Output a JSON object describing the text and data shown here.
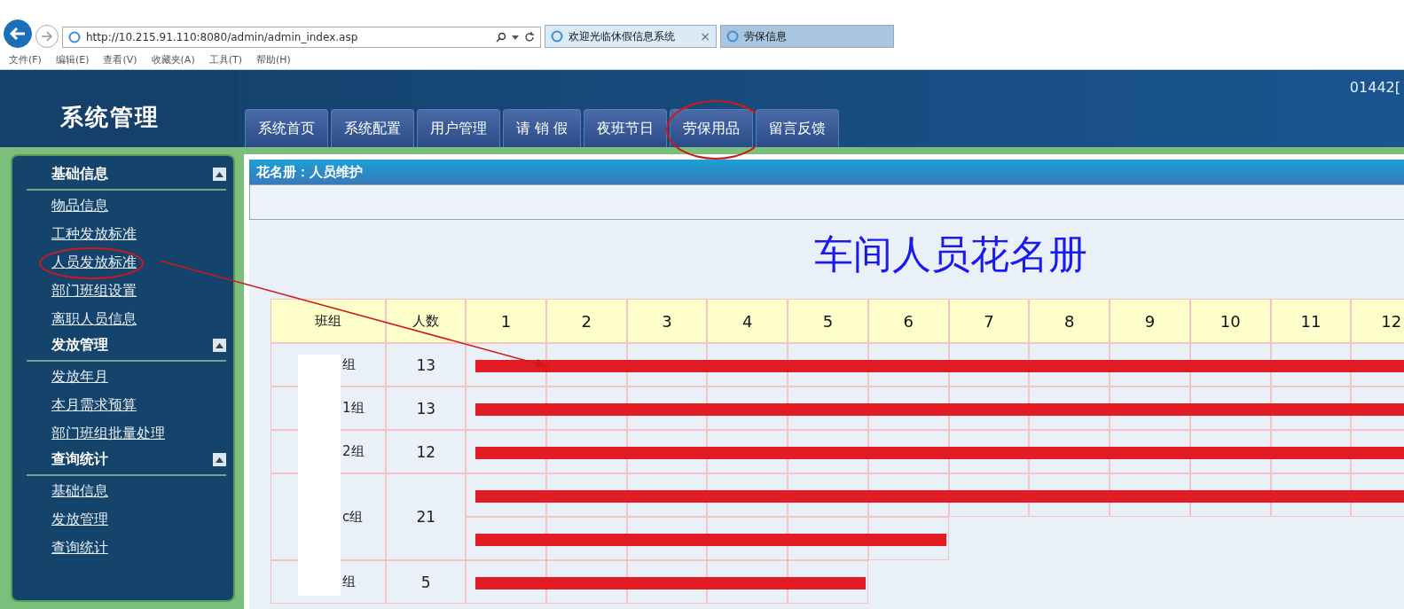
{
  "browser": {
    "address": "http://10.215.91.110:8080/admin/admin_index.asp",
    "tabs": [
      {
        "label": "欢迎光临休假信息系统",
        "selected": true,
        "close": "×"
      },
      {
        "label": "劳保信息",
        "selected": false
      }
    ],
    "menu": [
      "文件(F)",
      "编辑(E)",
      "查看(V)",
      "收藏夹(A)",
      "工具(T)",
      "帮助(H)"
    ]
  },
  "header": {
    "title": "系统管理",
    "user": "01442[",
    "tabs": [
      {
        "label": "系统首页",
        "selected": false,
        "circled": false
      },
      {
        "label": "系统配置",
        "selected": false,
        "circled": false
      },
      {
        "label": "用户管理",
        "selected": false,
        "circled": false
      },
      {
        "label": "请 销 假",
        "selected": false,
        "circled": false
      },
      {
        "label": "夜班节日",
        "selected": false,
        "circled": false
      },
      {
        "label": "劳保用品",
        "selected": false,
        "circled": true
      },
      {
        "label": "留言反馈",
        "selected": false,
        "circled": false
      }
    ]
  },
  "sidebar": {
    "sections": [
      {
        "title": "基础信息",
        "expanded": true,
        "items": [
          {
            "label": "物品信息",
            "circled": false
          },
          {
            "label": "工种发放标准",
            "circled": false
          },
          {
            "label": "人员发放标准",
            "circled": true
          },
          {
            "label": "部门班组设置",
            "circled": false
          },
          {
            "label": "离职人员信息",
            "circled": false
          }
        ]
      },
      {
        "title": "发放管理",
        "expanded": true,
        "items": [
          {
            "label": "发放年月",
            "circled": false
          },
          {
            "label": "本月需求预算",
            "circled": false
          },
          {
            "label": "部门班组批量处理",
            "circled": false
          }
        ]
      },
      {
        "title": "查询统计",
        "expanded": true,
        "items": [
          {
            "label": "基础信息",
            "circled": false
          },
          {
            "label": "发放管理",
            "circled": false
          },
          {
            "label": "查询统计",
            "circled": false
          }
        ]
      }
    ]
  },
  "panel": {
    "title": "花名册：人员维护",
    "heading": "车间人员花名册",
    "table": {
      "columns": [
        "班组",
        "人数",
        "1",
        "2",
        "3",
        "4",
        "5",
        "6",
        "7",
        "8",
        "9",
        "10",
        "11",
        "12"
      ],
      "rows": [
        {
          "group": "组",
          "count": "13",
          "cells": [
            {
              "redacted": true
            },
            {
              "redacted": true
            },
            {
              "redacted": true
            },
            {
              "redacted": true
            },
            {
              "redacted": true
            },
            {
              "redacted": true
            },
            {
              "redacted": true
            },
            {
              "redacted": true
            },
            {
              "redacted": true
            },
            {
              "redacted": true
            },
            {
              "redacted": true
            },
            {
              "redacted": true
            }
          ]
        },
        {
          "group": "1组",
          "count": "13",
          "cells": [
            {
              "redacted": true
            },
            {
              "redacted": true
            },
            {
              "redacted": true
            },
            {
              "redacted": true
            },
            {
              "redacted": true
            },
            {
              "redacted": true
            },
            {
              "redacted": true
            },
            {
              "redacted": true
            },
            {
              "redacted": true
            },
            {
              "redacted": true
            },
            {
              "redacted": true
            },
            {
              "redacted": true
            }
          ]
        },
        {
          "group": "2组",
          "count": "12",
          "cells": [
            {
              "redacted": true
            },
            {
              "redacted": true
            },
            {
              "redacted": true
            },
            {
              "redacted": true
            },
            {
              "redacted": true
            },
            {
              "redacted": true
            },
            {
              "redacted": true
            },
            {
              "redacted": true
            },
            {
              "redacted": true
            },
            {
              "redacted": true
            },
            {
              "redacted": true
            },
            {
              "redacted": true
            }
          ]
        },
        {
          "group": "c组",
          "count": "21",
          "cells": [
            {
              "redacted": true
            },
            {
              "redacted": true
            },
            {
              "redacted": true
            },
            {
              "redacted": true
            },
            {
              "redacted": true
            },
            {
              "redacted": true
            },
            {
              "redacted": true
            },
            {
              "redacted": true
            },
            {
              "redacted": true
            },
            {
              "redacted": true
            },
            {
              "redacted": true
            },
            {
              "redacted": true
            }
          ],
          "more": [
            {
              "redacted": true
            },
            {
              "redacted": true
            },
            {
              "redacted": true
            },
            {
              "redacted": true
            },
            {
              "redacted": true
            },
            {
              "redacted": true
            }
          ]
        },
        {
          "group": "组",
          "count": "5",
          "cells": [
            {
              "redacted": true
            },
            {
              "redacted": true
            },
            {
              "redacted": true
            },
            {
              "redacted": true
            },
            {
              "redacted": true
            }
          ]
        }
      ]
    }
  }
}
